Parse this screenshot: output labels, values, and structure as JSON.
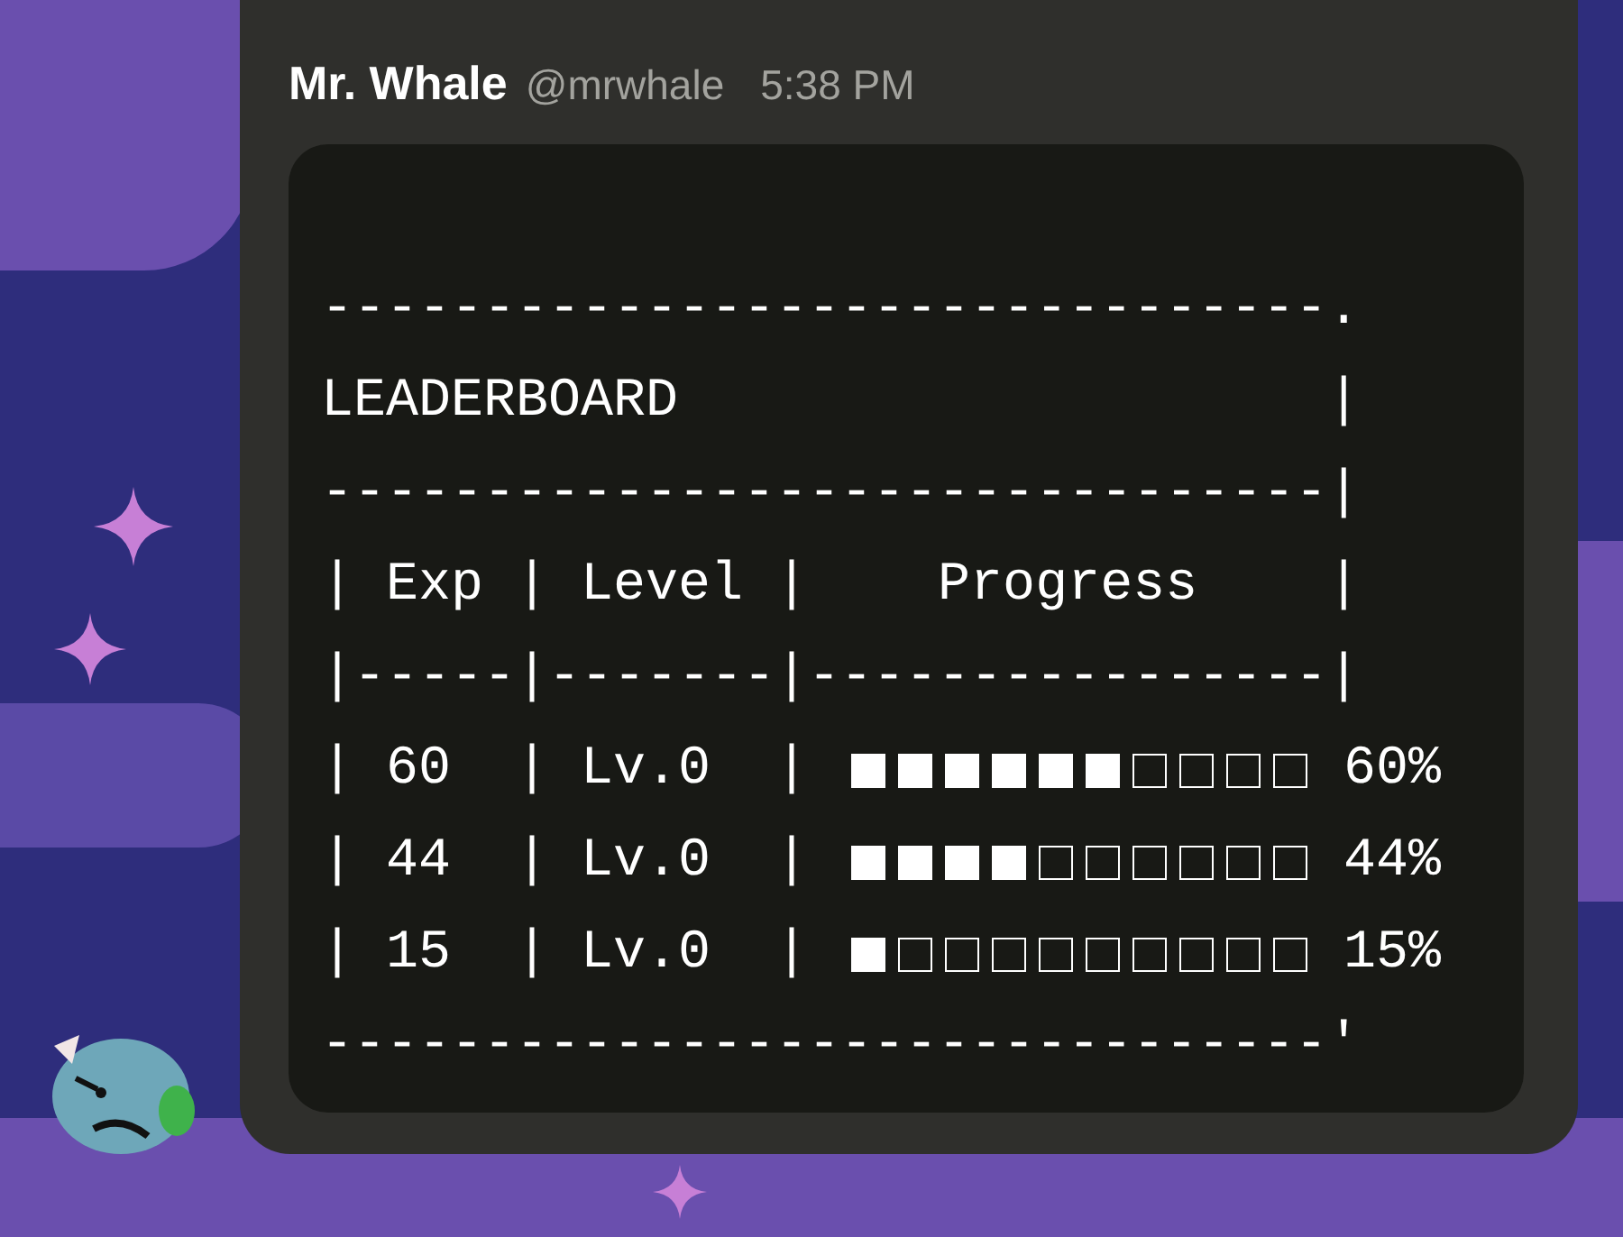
{
  "message": {
    "author": "Mr. Whale",
    "handle": "@mrwhale",
    "time": "5:38 PM"
  },
  "code_block": {
    "header_lines": [
      "-------------------------------.",
      "LEADERBOARD                    |",
      "-------------------------------|",
      "| Exp | Level |    Progress    |",
      "|-----|-------|----------------|"
    ],
    "rows": [
      {
        "text": "| 60  | Lv.0  |",
        "progress": {
          "level": 0.6
        },
        "reading": "60%"
      },
      {
        "text": "| 44  | Lv.0  |",
        "progress": {
          "level": 0.44
        },
        "reading": "44%"
      },
      {
        "text": "| 15  | Lv.0  |",
        "progress": {
          "level": 0.15
        },
        "reading": "15%"
      }
    ],
    "footer_line": "-------------------------------'"
  }
}
